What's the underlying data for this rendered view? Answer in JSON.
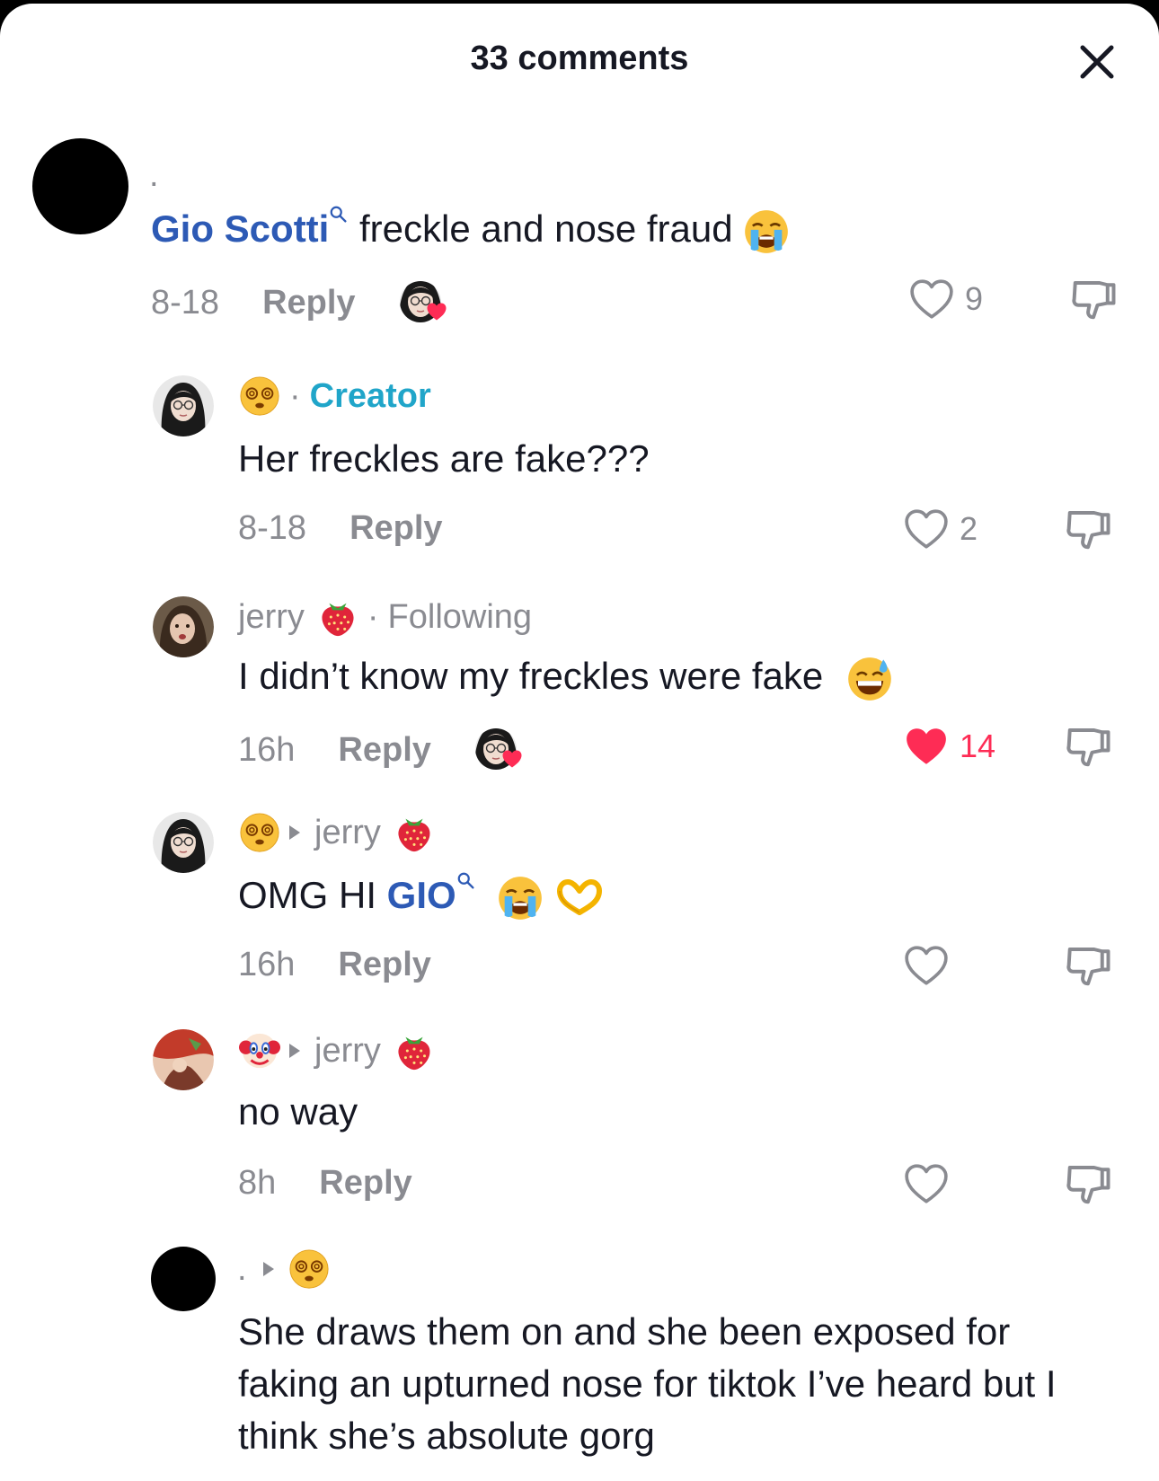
{
  "header": {
    "title": "33 comments",
    "close_icon": "close-icon"
  },
  "colors": {
    "accent_red": "#fe2c55",
    "creator_blue": "#20a5c9",
    "mention_blue": "#2d5ab5",
    "muted": "#8a8b91"
  },
  "comments": [
    {
      "username": ".",
      "mention": "Gio Scotti",
      "text": " freckle and nose fraud",
      "date": "8-18",
      "reply_label": "Reply",
      "likes": "9"
    },
    {
      "badge": "Creator",
      "text": "Her freckles are fake???",
      "date": "8-18",
      "reply_label": "Reply",
      "likes": "2"
    },
    {
      "username": "jerry",
      "status": "Following",
      "text": "I didn’t know my freckles were fake",
      "date": "16h",
      "reply_label": "Reply",
      "likes": "14"
    },
    {
      "reply_to": "jerry",
      "text_prefix": "OMG HI ",
      "mention": "GIO",
      "date": "16h",
      "reply_label": "Reply"
    },
    {
      "reply_to": "jerry",
      "text": "no way",
      "date": "8h",
      "reply_label": "Reply"
    },
    {
      "username": ".",
      "text": "She draws them on and she been exposed for faking an upturned nose for tiktok I’ve heard but I think she’s absolute gorg"
    }
  ]
}
